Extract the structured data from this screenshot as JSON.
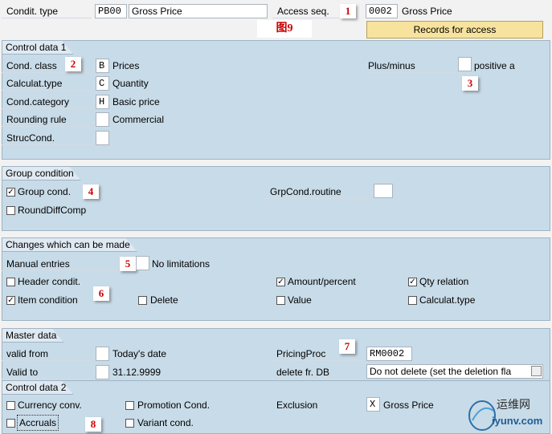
{
  "header": {
    "condit_type_label": "Condit. type",
    "condit_type_value": "PB00",
    "condit_type_desc": "Gross Price",
    "access_seq_label": "Access seq.",
    "access_seq_value": "0002",
    "access_seq_desc": "Gross Price",
    "records_button": "Records for access",
    "caption": "图9"
  },
  "markers": [
    "1",
    "2",
    "3",
    "4",
    "5",
    "6",
    "7",
    "8"
  ],
  "control_data_1": {
    "title": "Control data 1",
    "cond_class_label": "Cond. class",
    "cond_class_value": "B",
    "cond_class_desc": "Prices",
    "calculat_type_label": "Calculat.type",
    "calculat_type_value": "C",
    "calculat_type_desc": "Quantity",
    "cond_category_label": "Cond.category",
    "cond_category_value": "H",
    "cond_category_desc": "Basic price",
    "rounding_rule_label": "Rounding rule",
    "rounding_rule_value": "",
    "rounding_rule_desc": "Commercial",
    "struc_cond_label": "StrucCond.",
    "plus_minus_label": "Plus/minus",
    "plus_minus_desc": "positive a"
  },
  "group_condition": {
    "title": "Group condition",
    "group_cond_label": "Group cond.",
    "group_cond_checked": true,
    "round_diff_label": "RoundDiffComp",
    "round_diff_checked": false,
    "grpcond_routine_label": "GrpCond.routine"
  },
  "changes": {
    "title": "Changes which can be made",
    "manual_entries_label": "Manual entries",
    "manual_entries_desc": "No limitations",
    "header_condit_label": "Header condit.",
    "amount_percent_label": "Amount/percent",
    "qty_relation_label": "Qty relation",
    "item_condition_label": "Item condition",
    "delete_label": "Delete",
    "value_label": "Value",
    "calculat_type_label": "Calculat.type"
  },
  "master_data": {
    "title": "Master data",
    "valid_from_label": "valid from",
    "valid_from_desc": "Today's date",
    "valid_to_label": "Valid to",
    "valid_to_desc": "31.12.9999",
    "pricing_proc_label": "PricingProc",
    "pricing_proc_value": "RM0002",
    "delete_db_label": "delete fr. DB",
    "delete_db_value": "Do not delete (set the deletion fla"
  },
  "control_data_2": {
    "title": "Control data 2",
    "currency_conv_label": "Currency conv.",
    "promotion_cond_label": "Promotion Cond.",
    "exclusion_label": "Exclusion",
    "exclusion_value": "X",
    "exclusion_desc": "Gross Price",
    "accruals_label": "Accruals",
    "variant_cond_label": "Variant cond."
  },
  "watermark": {
    "text_cn": "运维网",
    "text_url": "iyunv.com"
  }
}
